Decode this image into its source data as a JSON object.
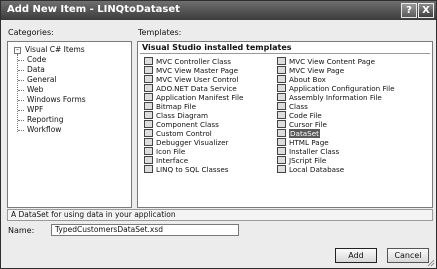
{
  "window": {
    "title": "Add New Item - LINQtoDataset",
    "help_glyph": "?",
    "close_glyph": "X"
  },
  "categories": {
    "label": "Categories:",
    "root": {
      "label": "Visual C# Items",
      "expander": "-"
    },
    "items": [
      "Code",
      "Data",
      "General",
      "Web",
      "Windows Forms",
      "WPF",
      "Reporting",
      "Workflow"
    ]
  },
  "templates": {
    "label": "Templates:",
    "section_header": "Visual Studio installed templates",
    "left_column": [
      "MVC Controller Class",
      "MVC View Master Page",
      "MVC View User Control",
      "ADO.NET Data Service",
      "Application Manifest File",
      "Bitmap File",
      "Class Diagram",
      "Component Class",
      "Custom Control",
      "Debugger Visualizer",
      "Icon File",
      "Interface",
      "LINQ to SQL Classes"
    ],
    "right_column": [
      "MVC View Content Page",
      "MVC View Page",
      "About Box",
      "Application Configuration File",
      "Assembly Information File",
      "Class",
      "Code File",
      "Cursor File",
      "DataSet",
      "HTML Page",
      "Installer Class",
      "JScript File",
      "Local Database"
    ],
    "selected": "DataSet"
  },
  "description": "A DataSet for using data in your application",
  "name_field": {
    "label": "Name:",
    "value": "TypedCustomersDataSet.xsd"
  },
  "buttons": {
    "add": "Add",
    "cancel": "Cancel"
  }
}
